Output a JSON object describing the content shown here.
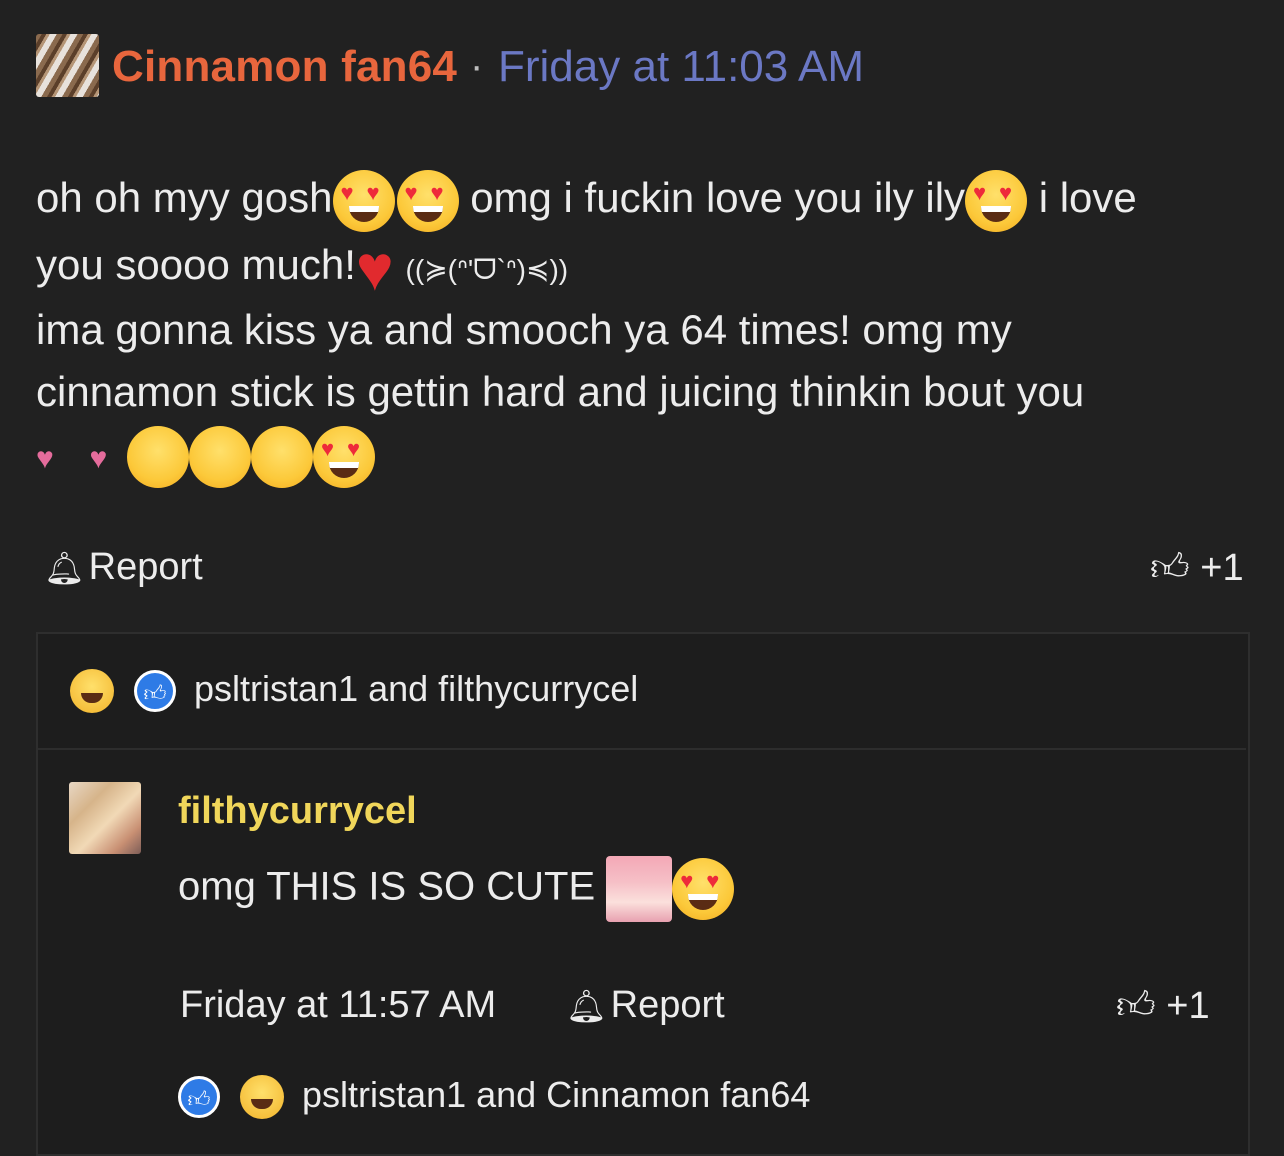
{
  "post": {
    "author": "Cinnamon fan64",
    "separator": "·",
    "time": "Friday at 11:03 AM",
    "line1_a": "oh oh myy gosh",
    "line1_b": "omg i fuckin love you ily ily",
    "line1_c": "i love",
    "line2_a": "you soooo much!",
    "kaomoji": "((≽(ᐢ'ᗜ`ᐢ)≼))",
    "line3": "ima gonna kiss ya and smooch ya 64 times! omg my",
    "line4": "cinnamon stick is gettin hard and juicing thinkin bout you",
    "report_label": "Report",
    "like_count": "+1"
  },
  "post_reactions": {
    "text": "psltristan1 and filthycurrycel"
  },
  "reply": {
    "author": "filthycurrycel",
    "text": "omg THIS IS SO CUTE",
    "time": "Friday at 11:57 AM",
    "report_label": "Report",
    "like_count": "+1",
    "reactions_text": "psltristan1 and Cinnamon fan64"
  },
  "icons": {
    "bell": "bell-icon",
    "thumbs_up": "thumbs-up-icon",
    "heart_eyes": "heart-eyes-emoji",
    "red_heart": "red-heart-emoji",
    "laugh_cry": "laugh-cry-emoji",
    "like_reaction": "like-reaction-icon"
  },
  "colors": {
    "background": "#212121",
    "author": "#e8663d",
    "timestamp": "#6b78c4",
    "reply_author": "#f0d65a",
    "text": "#ececec"
  }
}
